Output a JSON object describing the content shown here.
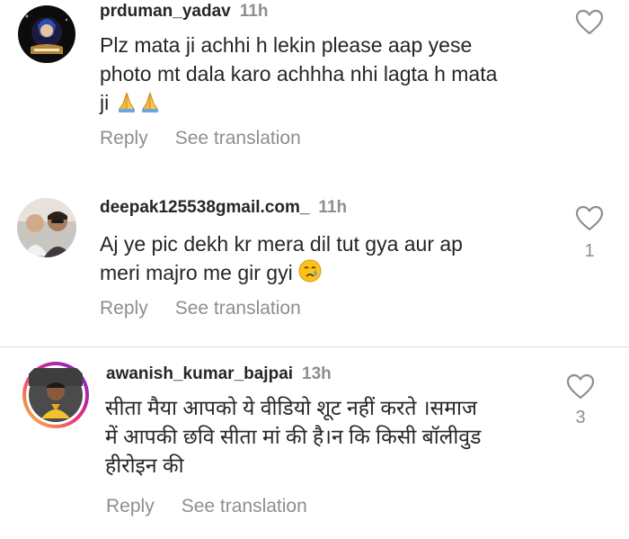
{
  "comments": [
    {
      "username": "prduman_yadav",
      "time": "11h",
      "lines": [
        "Plz mata ji achhi h lekin please aap yese",
        "photo mt dala karo achhha nhi lagta h mata",
        "ji"
      ],
      "emoji": "folded-hands-icon x2",
      "reply_label": "Reply",
      "translate_label": "See translation",
      "likes": ""
    },
    {
      "username": "deepak125538gmail.com_",
      "time": "11h",
      "lines": [
        "Aj ye pic dekh kr mera dil tut gya aur ap",
        "meri majro me gir gyi"
      ],
      "emoji": "crying-face-icon",
      "reply_label": "Reply",
      "translate_label": "See translation",
      "likes": "1"
    },
    {
      "username": "awanish_kumar_bajpai",
      "time": "13h",
      "lines": [
        "सीता मैया आपको ये वीडियो शूट नहीं करते ।समाज",
        "में आपकी छवि सीता मां की है।न कि किसी बॉलीवुड",
        "हीरोइन की"
      ],
      "reply_label": "Reply",
      "translate_label": "See translation",
      "likes": "3"
    }
  ],
  "colors": {
    "text": "#262626",
    "secondary": "#8e8e8e",
    "divider": "#dbdbdb",
    "story_ring_start": "#f9ce34",
    "story_ring_mid": "#ee2a7b",
    "story_ring_end": "#6228d7"
  }
}
